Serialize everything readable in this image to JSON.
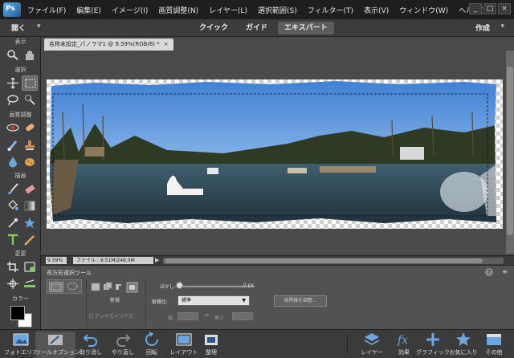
{
  "menubar": {
    "items": [
      "ファイル(F)",
      "編集(E)",
      "イメージ(I)",
      "画質調整(N)",
      "レイヤー(L)",
      "選択範囲(S)",
      "フィルター(T)",
      "表示(V)",
      "ウィンドウ(W)",
      "ヘルプ(H)"
    ],
    "window_controls": [
      "_",
      "□",
      "×"
    ]
  },
  "modebar": {
    "open_label": "開く",
    "tabs": [
      "クイック",
      "ガイド",
      "エキスパート"
    ],
    "active_tab": "エキスパート",
    "create_label": "作成"
  },
  "toolbox": {
    "sections": [
      "表示",
      "選択",
      "画質調整",
      "描画",
      "変更",
      "カラー"
    ],
    "tools": [
      "zoom",
      "hand",
      "move",
      "rectangular-marquee",
      "lasso",
      "quick-selection",
      "red-eye",
      "spot-healing",
      "smart-brush",
      "clone-stamp",
      "blur",
      "sponge",
      "brush",
      "eraser",
      "paint-bucket",
      "gradient",
      "eyedropper",
      "custom-shape",
      "type",
      "pencil",
      "crop",
      "recompose",
      "content-aware-move",
      "straighten"
    ],
    "selected_tool": "rectangular-marquee",
    "foreground_color": "#000000",
    "background_color": "#ffffff"
  },
  "document": {
    "tab_title": "名称未設定_パノラマ1 @ 9.59%(RGB/8) *",
    "tab_close": "×",
    "zoom": "9.59%",
    "file_info": "ファイル : 9.51M/248.0M"
  },
  "tool_options": {
    "title": "長方形選択ツール",
    "help": "?",
    "menu": "≡",
    "new_label": "新規",
    "antialias_label": "アンチエイリアス",
    "feather_label": "ぼかし:",
    "feather_value": "0 px",
    "aspect_label": "縦横比:",
    "aspect_value": "標準",
    "width_label": "幅",
    "height_label": "高さ",
    "refine_edge_label": "境界線を調整..."
  },
  "bottombar": {
    "left": [
      {
        "label": "フォトエリア",
        "icon": "photo-bin-icon"
      },
      {
        "label": "ツールオプション",
        "icon": "tool-options-icon"
      },
      {
        "label": "取り消し",
        "icon": "undo-icon"
      },
      {
        "label": "やり直し",
        "icon": "redo-icon"
      },
      {
        "label": "回転",
        "icon": "rotate-icon"
      },
      {
        "label": "レイアウト",
        "icon": "layout-icon"
      },
      {
        "label": "整理",
        "icon": "organizer-icon"
      }
    ],
    "right": [
      {
        "label": "レイヤー",
        "icon": "layers-icon"
      },
      {
        "label": "効果",
        "icon": "fx-icon"
      },
      {
        "label": "グラフィック",
        "icon": "graphics-icon"
      },
      {
        "label": "お気に入り",
        "icon": "favorites-icon"
      },
      {
        "label": "その他",
        "icon": "more-icon"
      }
    ],
    "active": "ツールオプション"
  },
  "colors": {
    "menubar": "#1e1e1e",
    "panel": "#404040",
    "accent": "#5c5c5c"
  }
}
